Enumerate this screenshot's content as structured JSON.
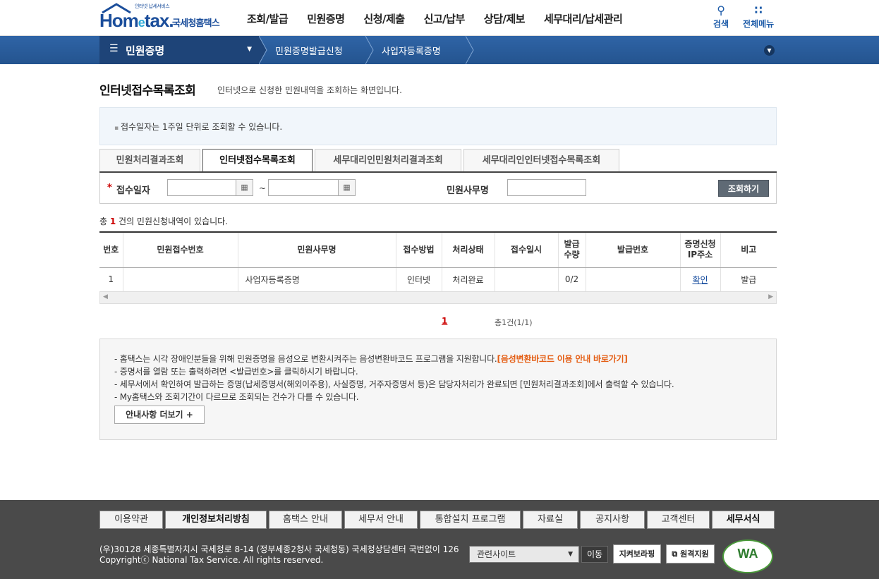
{
  "header": {
    "logo_small": "인터넷 납세서비스",
    "logo_main_a": "Hom",
    "logo_main_e": "e",
    "logo_main_b": "tax.",
    "logo_kor": "국세청홈택스",
    "gnb": [
      "조회/발급",
      "민원증명",
      "신청/제출",
      "신고/납부",
      "상담/제보",
      "세무대리/납세관리"
    ],
    "search_label": "검색",
    "allmenu_label": "전체메뉴"
  },
  "location": {
    "menu_label": "민원증명",
    "crumb1": "민원증명발급신청",
    "crumb2": "사업자등록증명"
  },
  "page": {
    "title": "인터넷접수목록조회",
    "desc": "인터넷으로 신청한 민원내역을 조회하는 화면입니다.",
    "notice": "접수일자는 1주일 단위로 조회할 수 있습니다."
  },
  "tabs": [
    "민원처리결과조회",
    "인터넷접수목록조회",
    "세무대리인민원처리결과조회",
    "세무대리인인터넷접수목록조회"
  ],
  "search": {
    "date_label": "접수일자",
    "tilde": "~",
    "office_label": "민원사무명",
    "date_from": "",
    "date_to": "",
    "office_value": "",
    "button": "조회하기"
  },
  "count": {
    "prefix": "총 ",
    "num": "1",
    "suffix": " 건의 민원신청내역이 있습니다."
  },
  "table": {
    "headers": [
      "번호",
      "민원접수번호",
      "민원사무명",
      "접수방법",
      "처리상태",
      "접수일시",
      "발급\n수량",
      "발급번호",
      "증명신청\nIP주소",
      "비고"
    ],
    "rows": [
      [
        "1",
        "",
        "사업자등록증명",
        "인터넷",
        "처리완료",
        "",
        "0/2",
        "",
        "확인",
        "발급"
      ]
    ]
  },
  "pager": {
    "current": "1",
    "info": "총1건(1/1)"
  },
  "guide": {
    "line1": "- 홈택스는 시각 장애인분들을 위해 민원증명을 음성으로 변환시켜주는 음성변환바코드 프로그램을 지원합니다.",
    "line1_link": "[음성변환바코드 이용 안내 바로가기]",
    "line2": "- 증명서를 열람 또는 출력하려면 <발급번호>를 클릭하시기 바랍니다.",
    "line3": "- 세무서에서 확인하여 발급하는 증명(납세증명서(해외이주용), 사실증명, 거주자증명서 등)은 담당자처리가 완료되면 [민원처리결과조회]에서 출력할 수 있습니다.",
    "line4": "- My홈택스와 조회기간이 다르므로 조회되는 건수가 다를 수 있습니다.",
    "more": "안내사항 더보기 +"
  },
  "footer": {
    "nav": [
      "이용약관",
      "개인정보처리방침",
      "홈택스 안내",
      "세무서 안내",
      "통합설치 프로그램",
      "자료실",
      "공지사항",
      "고객센터",
      "세무서식"
    ],
    "address": "(우)30128 세종특별자치시 국세청로 8-14 (정부세종2청사 국세청동) 국세청상담센터 국번없이 126",
    "copyright": "Copyrightⓒ National Tax Service. All rights reserved.",
    "related": "관련사이트",
    "go": "이동",
    "btn1": "지켜보라핑",
    "btn2": "원격지원",
    "wa_mark": "WA"
  }
}
